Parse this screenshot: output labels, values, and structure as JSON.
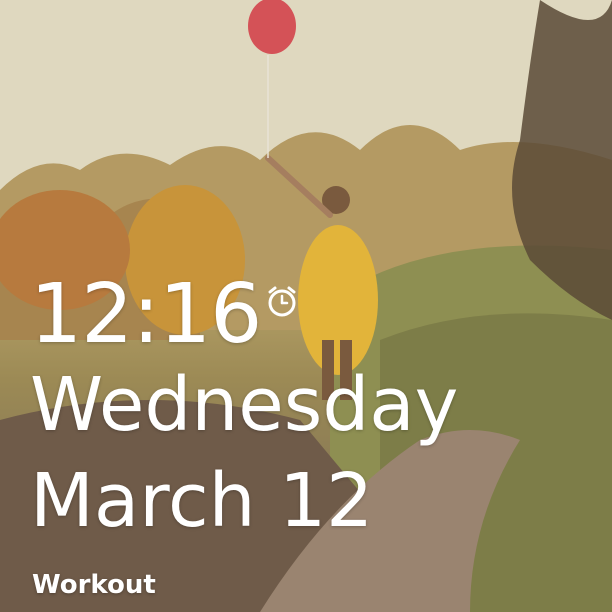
{
  "lockscreen": {
    "time": "12:16",
    "day": "Wednesday",
    "date": "March 12",
    "next_event": "Workout",
    "alarm_icon": "alarm-clock-icon",
    "text_color": "#ffffff"
  },
  "wallpaper": {
    "image": "girl-with-red-balloon-photo"
  }
}
